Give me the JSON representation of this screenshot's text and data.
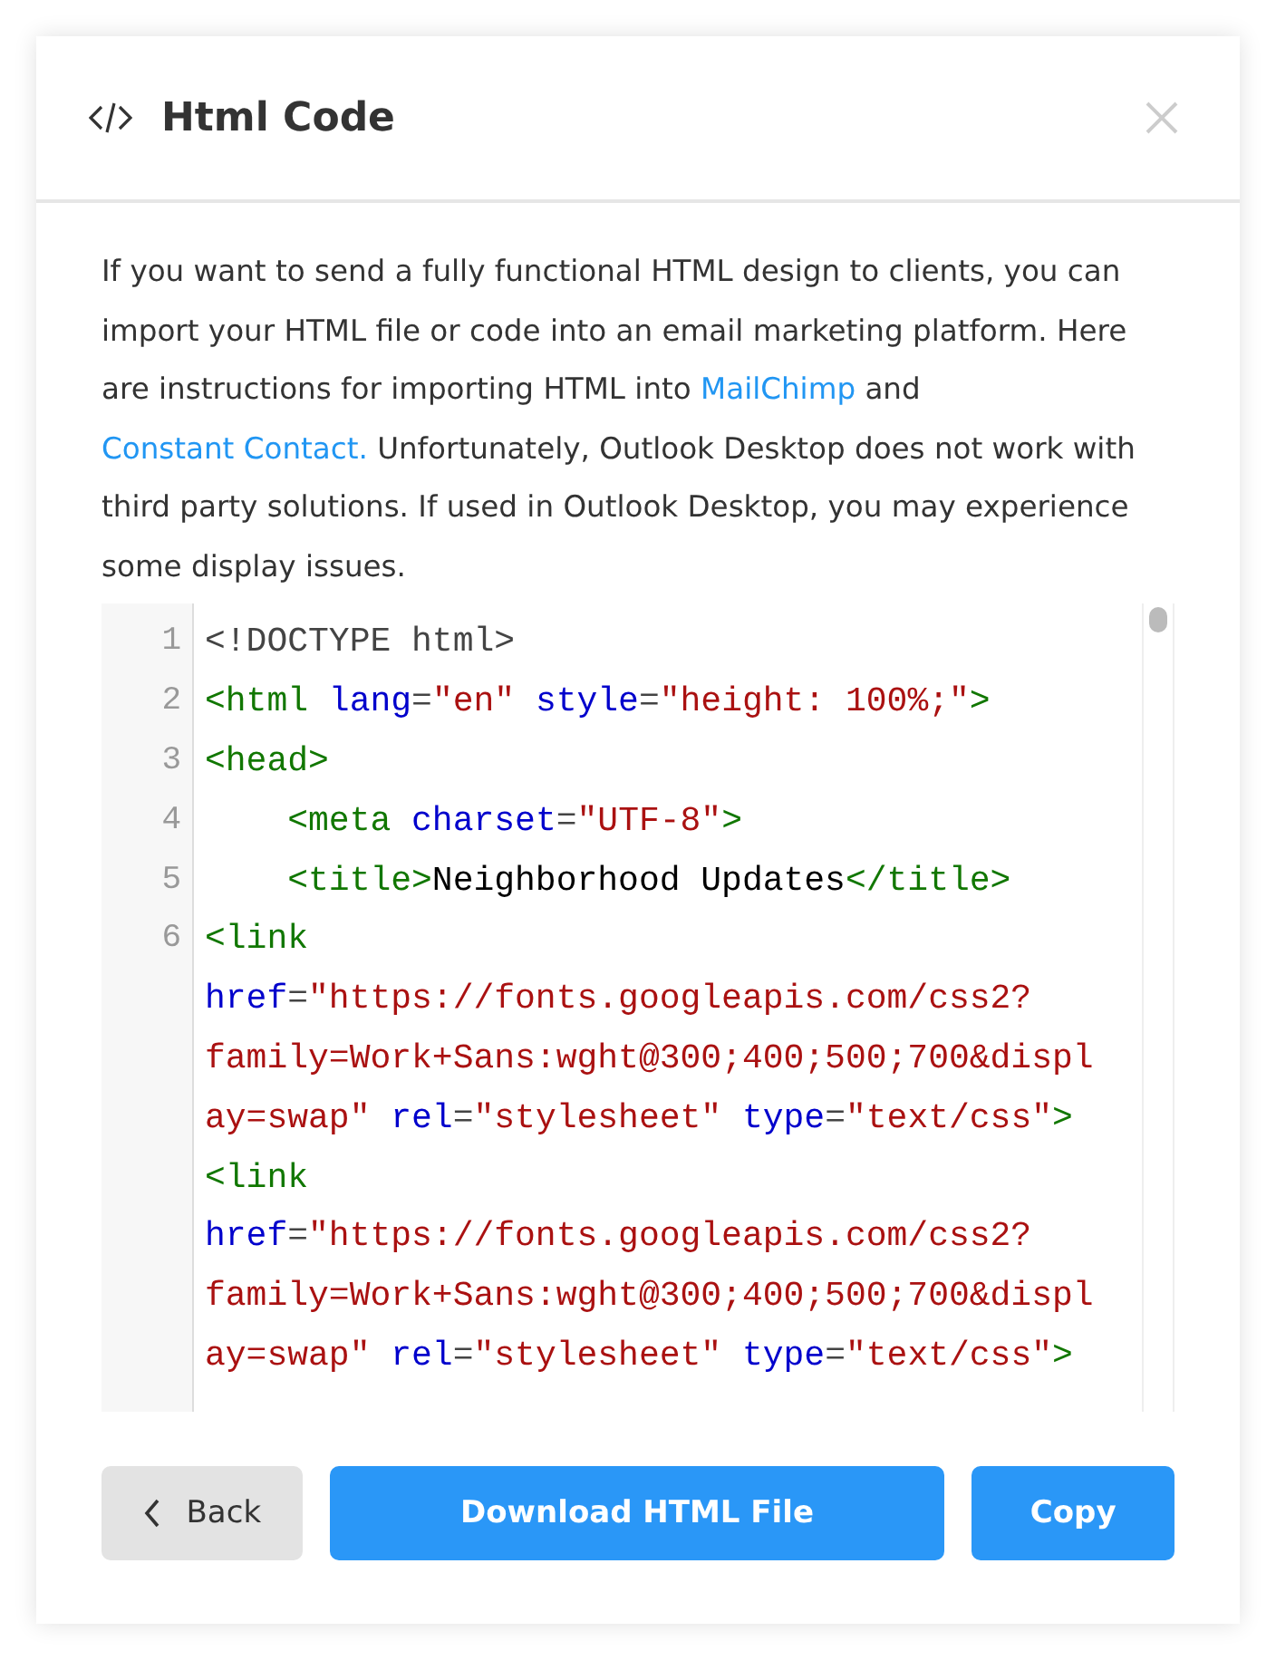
{
  "dialog": {
    "title": "Html Code"
  },
  "intro": [
    {
      "kind": "text",
      "text": "If you want to send a fully functional HTML design to clients, you can import your HTML file or code into an email marketing platform. Here are instructions for importing HTML into "
    },
    {
      "kind": "link",
      "text": "MailChimp"
    },
    {
      "kind": "text",
      "text": " and "
    },
    {
      "kind": "link",
      "text": "Constant Contact."
    },
    {
      "kind": "text",
      "text": " Unfortunately, Outlook Desktop does not work with third party solutions. If used in Outlook Desktop, you may experience some display issues."
    }
  ],
  "code_lines": [
    {
      "number": "1",
      "tokens": [
        {
          "kind": "plain",
          "text": "<!DOCTYPE html>"
        }
      ]
    },
    {
      "number": "2",
      "tokens": [
        {
          "kind": "tag",
          "text": "<html "
        },
        {
          "kind": "attr",
          "text": "lang"
        },
        {
          "kind": "plain",
          "text": "="
        },
        {
          "kind": "value",
          "text": "\"en\""
        },
        {
          "kind": "attr",
          "text": " style"
        },
        {
          "kind": "plain",
          "text": "="
        },
        {
          "kind": "value",
          "text": "\"height: 100%;\""
        },
        {
          "kind": "tag",
          "text": ">"
        }
      ]
    },
    {
      "number": "3",
      "tokens": [
        {
          "kind": "tag",
          "text": "<head>"
        }
      ]
    },
    {
      "number": "4",
      "tokens": [
        {
          "kind": "tag",
          "text": "    <meta "
        },
        {
          "kind": "attr",
          "text": "charset"
        },
        {
          "kind": "plain",
          "text": "="
        },
        {
          "kind": "value",
          "text": "\"UTF-8\""
        },
        {
          "kind": "tag",
          "text": ">"
        }
      ]
    },
    {
      "number": "5",
      "tokens": [
        {
          "kind": "tag",
          "text": "    <title>"
        },
        {
          "kind": "text",
          "text": "Neighborhood Updates"
        },
        {
          "kind": "tag",
          "text": "</title>"
        }
      ]
    },
    {
      "number": "6",
      "tokens": [
        {
          "kind": "tag",
          "text": "<link"
        }
      ]
    },
    {
      "tokens": [
        {
          "kind": "attr",
          "text": "href"
        },
        {
          "kind": "plain",
          "text": "="
        },
        {
          "kind": "value",
          "text": "\"https://fonts.googleapis.com/css2?"
        }
      ]
    },
    {
      "tokens": [
        {
          "kind": "value",
          "text": "family=Work+Sans:wght@300;400;500;700&displ"
        }
      ]
    },
    {
      "tokens": [
        {
          "kind": "value",
          "text": "ay=swap\""
        },
        {
          "kind": "attr",
          "text": " rel"
        },
        {
          "kind": "plain",
          "text": "="
        },
        {
          "kind": "value",
          "text": "\"stylesheet\""
        },
        {
          "kind": "attr",
          "text": " type"
        },
        {
          "kind": "plain",
          "text": "="
        },
        {
          "kind": "value",
          "text": "\"text/css\""
        },
        {
          "kind": "tag",
          "text": ">"
        }
      ]
    },
    {
      "tokens": [
        {
          "kind": "tag",
          "text": "<link"
        }
      ]
    },
    {
      "tokens": [
        {
          "kind": "attr",
          "text": "href"
        },
        {
          "kind": "plain",
          "text": "="
        },
        {
          "kind": "value",
          "text": "\"https://fonts.googleapis.com/css2?"
        }
      ]
    },
    {
      "tokens": [
        {
          "kind": "value",
          "text": "family=Work+Sans:wght@300;400;500;700&displ"
        }
      ]
    },
    {
      "tokens": [
        {
          "kind": "value",
          "text": "ay=swap\""
        },
        {
          "kind": "attr",
          "text": " rel"
        },
        {
          "kind": "plain",
          "text": "="
        },
        {
          "kind": "value",
          "text": "\"stylesheet\""
        },
        {
          "kind": "attr",
          "text": " type"
        },
        {
          "kind": "plain",
          "text": "="
        },
        {
          "kind": "value",
          "text": "\"text/css\""
        },
        {
          "kind": "tag",
          "text": ">"
        }
      ]
    }
  ],
  "buttons": [
    {
      "kind": "back",
      "label": "Back"
    },
    {
      "kind": "primary",
      "label": "Download HTML File"
    },
    {
      "kind": "primary",
      "label": "Copy"
    }
  ]
}
